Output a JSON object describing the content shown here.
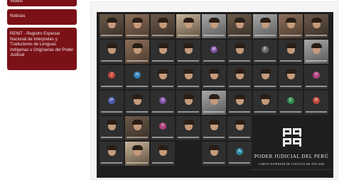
{
  "sidebar": {
    "items": [
      {
        "label": "Videos"
      },
      {
        "label": "Noticias"
      },
      {
        "label": "RENIT - Registro Especial Nacional de Intérpretes y Traductores de Lenguas Indígenas u Originarias del Poder Judicial"
      }
    ]
  },
  "image": {
    "logo": {
      "title": "PODER JUDICIAL DEL PERÚ",
      "subtitle": "CORTE SUPERIOR DE JUSTICIA DE ÁNCASH"
    },
    "tiles": [
      "photo",
      "photo2",
      "photo",
      "photo4",
      "photo3",
      "photo",
      "photo3",
      "photo2",
      "photo",
      "face",
      "photo2",
      "face",
      "face",
      "M",
      "face",
      "F",
      "face",
      "photo3",
      "J",
      "H",
      "face",
      "face",
      "face",
      "face",
      "face",
      "face",
      "Y",
      "P",
      "face",
      "S",
      "face",
      "photo3",
      "face",
      "face",
      "E",
      "R",
      "face",
      "photo",
      "Y",
      "face",
      "face",
      "face",
      "",
      "",
      "",
      "face",
      "photo4",
      "face",
      "",
      "face",
      "A",
      "",
      "",
      ""
    ],
    "avatar_colors": {
      "M": "#7b4fa3",
      "F": "#6f6f6f",
      "J": "#c1473b",
      "H": "#2f7fb8",
      "Y": "#b2437f",
      "P": "#4e5bb0",
      "S": "#7b4fa3",
      "E": "#2f8a4e",
      "R": "#c1473b",
      "A": "#2f8aa0"
    }
  }
}
